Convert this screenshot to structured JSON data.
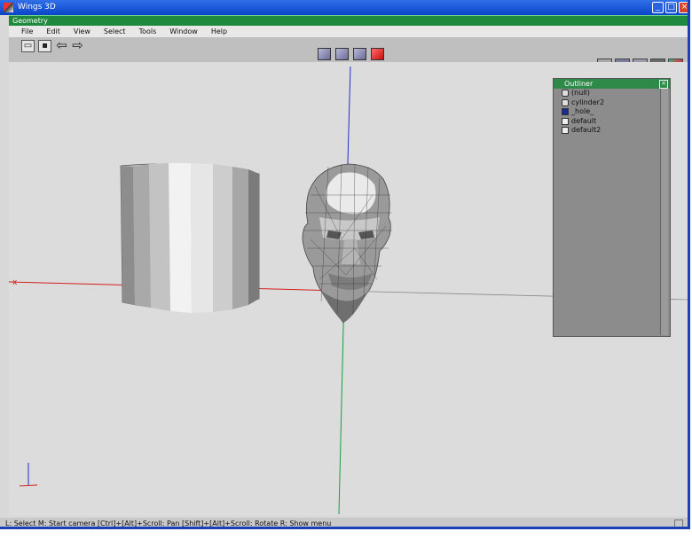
{
  "window": {
    "title": "Wings 3D"
  },
  "window_controls": {
    "minimize": "_",
    "maximize": "□",
    "close": "×"
  },
  "geometry_bar": {
    "label": "Geometry"
  },
  "menu": {
    "items": [
      "File",
      "Edit",
      "View",
      "Select",
      "Tools",
      "Window",
      "Help"
    ]
  },
  "toolbar": {
    "arrow_back": "⇦",
    "arrow_forward": "⇨"
  },
  "outliner": {
    "title": "Outliner",
    "close": "×",
    "items": [
      {
        "label": "(null)",
        "icon": "object-icon"
      },
      {
        "label": "cylinder2",
        "icon": "object-icon"
      },
      {
        "label": "_hole_",
        "icon": "material-blue-icon"
      },
      {
        "label": "default",
        "icon": "material-icon"
      },
      {
        "label": "default2",
        "icon": "material-icon"
      }
    ]
  },
  "statusbar": {
    "text": "L: Select   M: Start camera   [Ctrl]+[Alt]+Scroll: Pan   [Shift]+[Alt]+Scroll: Rotate   R: Show menu"
  },
  "colors": {
    "title_blue": "#0a45c8",
    "geometry_green": "#1f8a3e",
    "axis_x": "#d22020",
    "axis_y": "#12a040",
    "axis_z": "#2030c8",
    "active_mode": "#c81010"
  }
}
